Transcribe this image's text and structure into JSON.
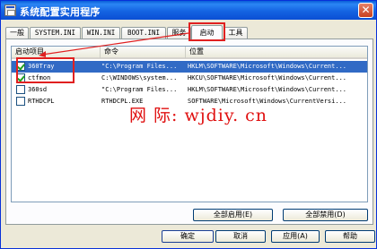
{
  "window": {
    "title": "系统配置实用程序",
    "close_glyph": "✕"
  },
  "tabs": [
    {
      "label": "一般"
    },
    {
      "label": "SYSTEM.INI"
    },
    {
      "label": "WIN.INI"
    },
    {
      "label": "BOOT.INI"
    },
    {
      "label": "服务"
    },
    {
      "label": "启动"
    },
    {
      "label": "工具"
    }
  ],
  "active_tab": "启动",
  "list": {
    "columns": [
      "启动项目",
      "命令",
      "位置"
    ],
    "rows": [
      {
        "checked": true,
        "name": "360Tray",
        "command": "\"C:\\Program Files...",
        "location": "HKLM\\SOFTWARE\\Microsoft\\Windows\\Current...",
        "selected": true
      },
      {
        "checked": true,
        "name": "ctfmon",
        "command": "C:\\WINDOWS\\system...",
        "location": "HKCU\\SOFTWARE\\Microsoft\\Windows\\Current...",
        "selected": false
      },
      {
        "checked": false,
        "name": "360sd",
        "command": "\"C:\\Program Files...",
        "location": "HKLM\\SOFTWARE\\Microsoft\\Windows\\Current...",
        "selected": false
      },
      {
        "checked": false,
        "name": "RTHDCPL",
        "command": "RTHDCPL.EXE",
        "location": "SOFTWARE\\Microsoft\\Windows\\CurrentVersi...",
        "selected": false
      }
    ]
  },
  "watermark": "网 际: wjdiy. cn",
  "panel_buttons": {
    "enable_all": "全部启用(E)",
    "disable_all": "全部禁用(D)"
  },
  "dialog_buttons": {
    "ok": "确定",
    "cancel": "取消",
    "apply": "应用(A)",
    "help": "帮助"
  },
  "colors": {
    "titlebar": "#0b4fd4",
    "selection": "#316ac5",
    "annotation": "#e02020",
    "check": "#21a121"
  }
}
